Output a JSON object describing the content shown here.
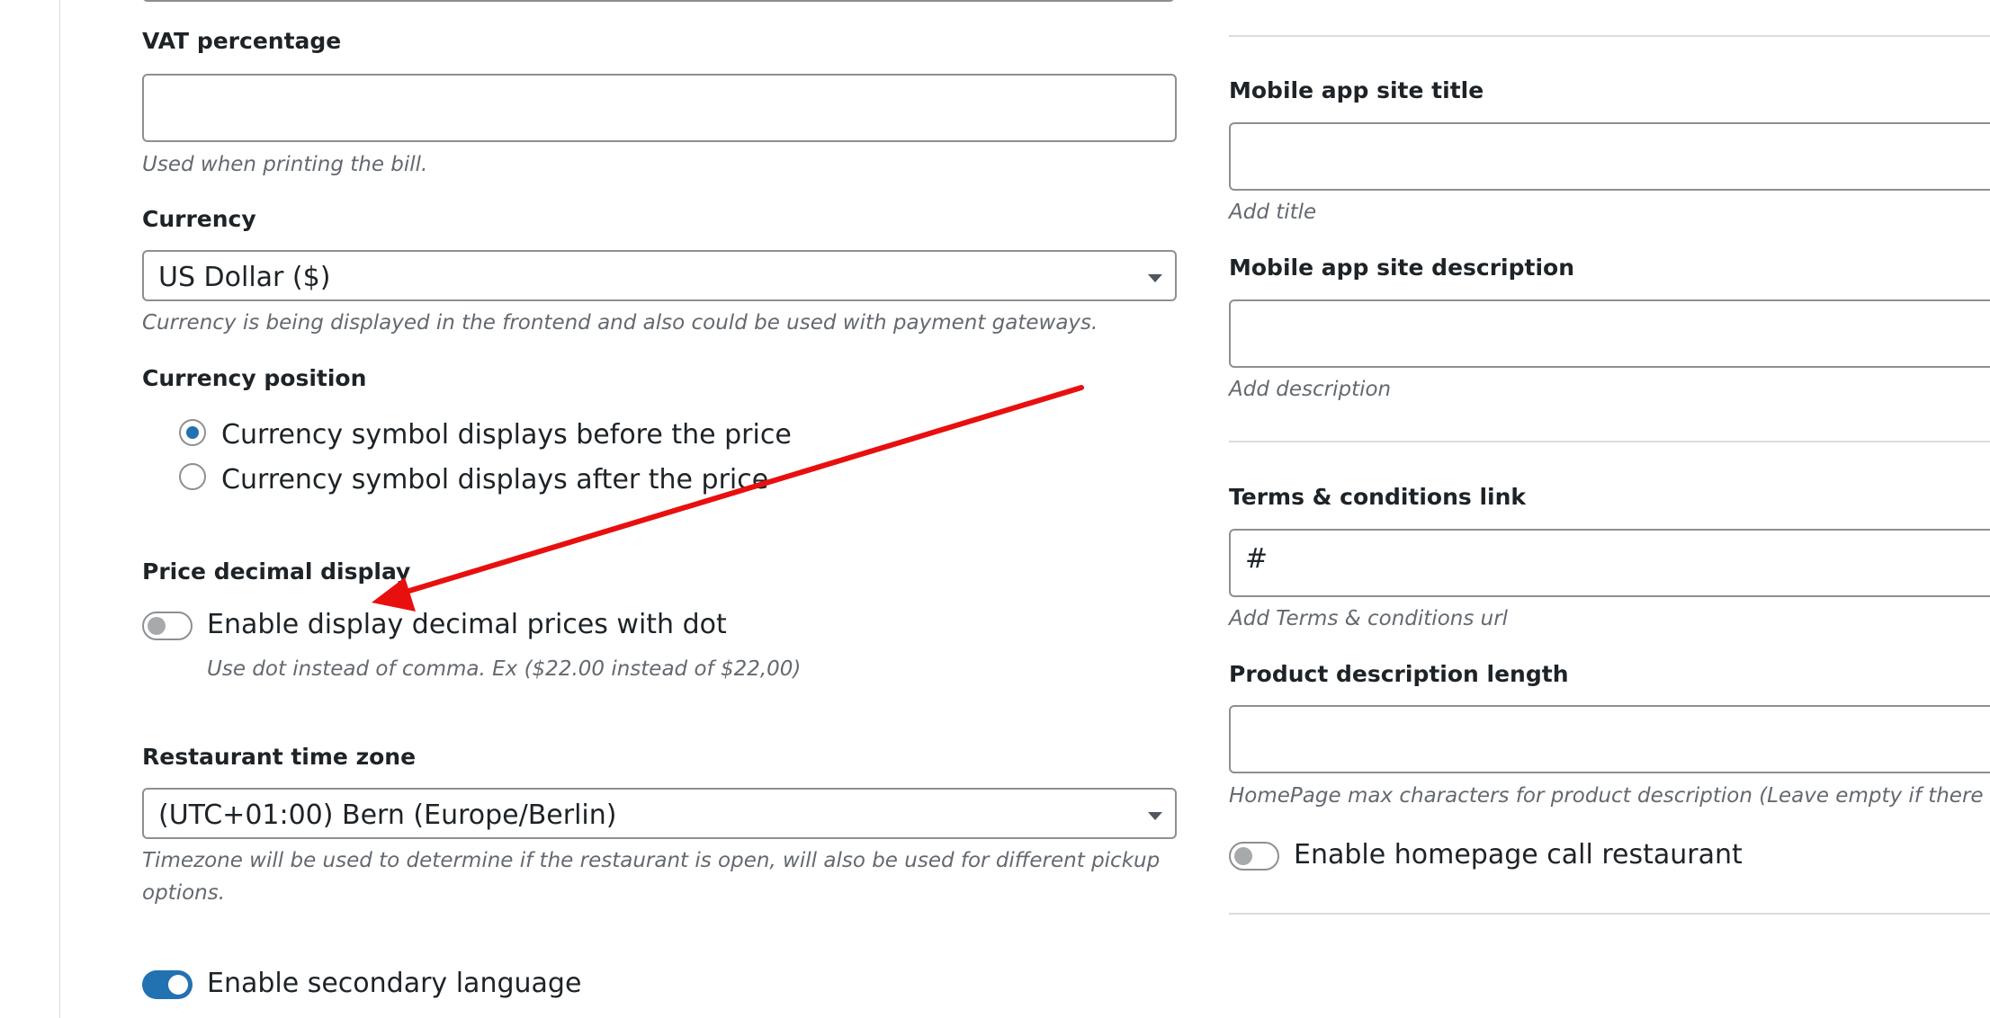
{
  "vat": {
    "label": "VAT percentage",
    "value": "",
    "help": "Used when printing the bill."
  },
  "currency": {
    "label": "Currency",
    "selected": "US Dollar ($)",
    "help": "Currency is being displayed in the frontend and also could be used with payment gateways."
  },
  "currency_position": {
    "label": "Currency position",
    "options": [
      {
        "label": "Currency symbol displays before the price",
        "checked": true
      },
      {
        "label": "Currency symbol displays after the price",
        "checked": false
      }
    ]
  },
  "price_decimal": {
    "label": "Price decimal display",
    "toggle_label": "Enable display decimal prices with dot",
    "enabled": false,
    "help": "Use dot instead of comma. Ex ($22.00 instead of $22,00)"
  },
  "timezone": {
    "label": "Restaurant time zone",
    "selected": "(UTC+01:00) Bern (Europe/Berlin)",
    "help": "Timezone will be used to determine if the restaurant is open, will also be used for different pickup options."
  },
  "secondary_language": {
    "toggle_label": "Enable secondary language",
    "enabled": true
  },
  "mobile_title": {
    "label": "Mobile app site title",
    "value": "",
    "help": "Add title"
  },
  "mobile_description": {
    "label": "Mobile app site description",
    "value": "",
    "help": "Add description"
  },
  "terms_link": {
    "label": "Terms & conditions link",
    "value": "#",
    "help": "Add Terms & conditions url"
  },
  "product_desc_length": {
    "label": "Product description length",
    "value": "",
    "help": "HomePage max characters for product description (Leave empty if there is"
  },
  "homepage_call": {
    "toggle_label": "Enable homepage call restaurant",
    "enabled": false
  },
  "annotation": {
    "arrow_color": "#e8100f"
  },
  "colors": {
    "accent": "#2271b1",
    "border": "#8c8f94",
    "help_text": "#646970"
  }
}
